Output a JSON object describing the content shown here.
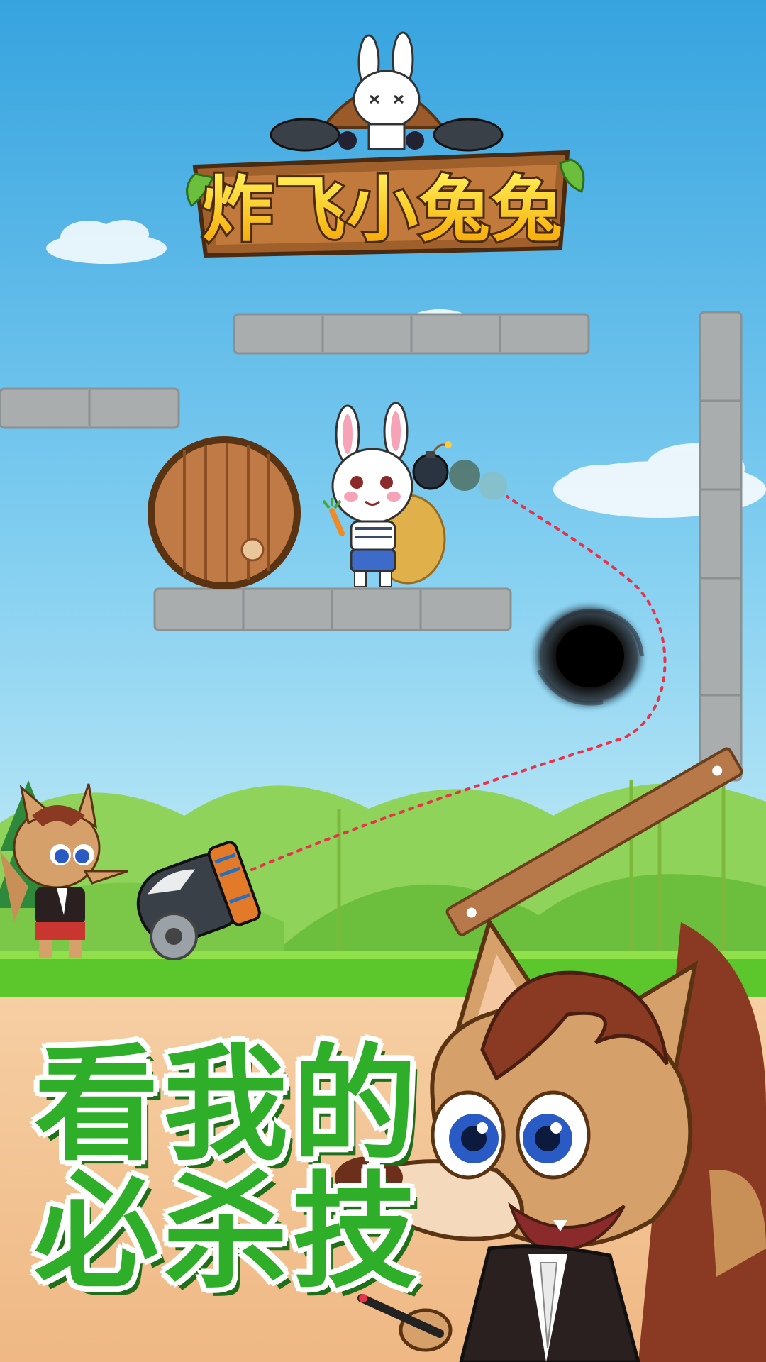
{
  "game": {
    "title": "炸飞小兔兔",
    "slogan_line1": "看我的",
    "slogan_line2": "必杀技"
  },
  "colors": {
    "sky_top": "#3aa6e0",
    "sky_bottom": "#bfe9f5",
    "grass": "#5cc72c",
    "ground": "#f3c494",
    "title_yellow": "#ffd21a",
    "slogan_green": "#2fae2a",
    "trajectory": "#e8324b",
    "stone": "#a9adae",
    "plank": "#b7794a"
  },
  "icons": [
    "rabbit-character",
    "wolf-character",
    "cannon-icon",
    "bomb-icon",
    "black-hole-icon",
    "wooden-door-icon"
  ]
}
